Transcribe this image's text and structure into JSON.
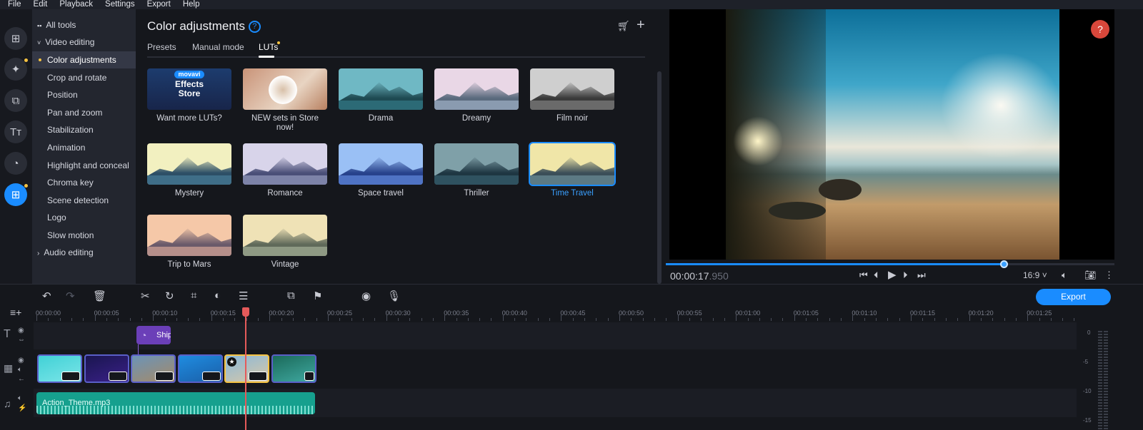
{
  "menu": [
    "File",
    "Edit",
    "Playback",
    "Settings",
    "Export",
    "Help"
  ],
  "rail": [
    {
      "icon": "import-icon",
      "glyph": "⊞"
    },
    {
      "icon": "magic-wand-icon",
      "glyph": "✦"
    },
    {
      "icon": "transitions-icon",
      "glyph": "⧉"
    },
    {
      "icon": "titles-icon",
      "glyph": "Tт"
    },
    {
      "icon": "stickers-icon",
      "glyph": "◔"
    },
    {
      "icon": "more-tools-icon",
      "glyph": "⊞"
    }
  ],
  "side": {
    "all_tools": "All tools",
    "video_editing": "Video editing",
    "items": [
      "Color adjustments",
      "Crop and rotate",
      "Position",
      "Pan and zoom",
      "Stabilization",
      "Animation",
      "Highlight and conceal",
      "Chroma key",
      "Scene detection",
      "Logo",
      "Slow motion"
    ],
    "audio_editing": "Audio editing"
  },
  "panel": {
    "title": "Color adjustments",
    "tabs": [
      "Presets",
      "Manual mode",
      "LUTs"
    ],
    "active_tab": "LUTs",
    "store": {
      "brand": "movavi",
      "line1": "Effects",
      "line2": "Store"
    },
    "luts": [
      "Want more LUTs?",
      "NEW sets in Store now!",
      "Drama",
      "Dreamy",
      "Film noir",
      "Mystery",
      "Romance",
      "Space travel",
      "Thriller",
      "Time Travel",
      "Trip to Mars",
      "Vintage"
    ],
    "selected": "Time Travel"
  },
  "player": {
    "time_main": "00:00:17",
    "time_ms": ".950",
    "progress": 0.753,
    "aspect": "16:9 ˅"
  },
  "timeline": {
    "export": "Export",
    "ruler": [
      "00:00:00",
      "00:00:05",
      "00:00:10",
      "00:00:15",
      "00:00:20",
      "00:00:25",
      "00:00:30",
      "00:00:35",
      "00:00:40",
      "00:00:45",
      "00:00:50",
      "00:00:55",
      "00:01:00",
      "00:01:05",
      "00:01:10",
      "00:01:15",
      "00:01:20",
      "00:01:25"
    ],
    "playhead": "00:00:17.950",
    "title_clip": "Ship",
    "audio_clip": "Action_Theme.mp3",
    "meter": [
      "0",
      "-5",
      "-10",
      "-15"
    ]
  },
  "colors": {
    "accent": "#1a8cff",
    "playhead": "#e55a5a",
    "audio": "#16a08e",
    "title_clip": "#6b3fb8",
    "selected_clip": "#f5c242"
  }
}
